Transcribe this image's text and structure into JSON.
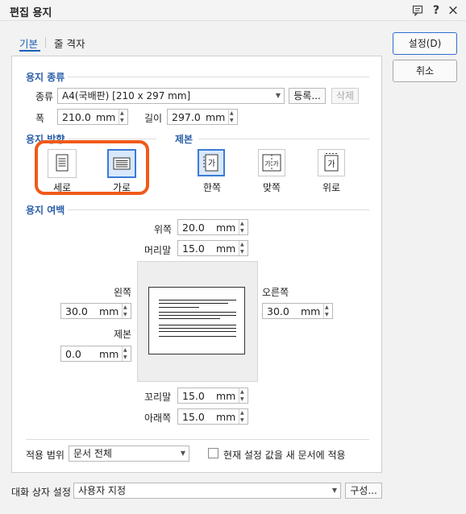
{
  "window": {
    "title": "편집 용지",
    "help_icon": "?",
    "close_icon": "×"
  },
  "tabs": [
    {
      "label": "기본"
    },
    {
      "label": "줄 격자"
    }
  ],
  "paper_kind": {
    "section_title": "용지 종류",
    "kind_label": "종류",
    "kind_value": "A4(국배판) [210 x 297 mm]",
    "register_button": "등록...",
    "delete_button": "삭제",
    "width_label": "폭",
    "width_value": "210.0",
    "width_unit": "mm",
    "length_label": "길이",
    "length_value": "297.0",
    "length_unit": "mm"
  },
  "orientation": {
    "section_title": "용지 방향",
    "portrait": "세로",
    "landscape": "가로",
    "selected": "landscape"
  },
  "binding": {
    "section_title": "제본",
    "single": "한쪽",
    "facing": "맞쪽",
    "top": "위로",
    "icon_glyph": "가",
    "selected": "single"
  },
  "margins": {
    "section_title": "용지 여백",
    "top_label": "위쪽",
    "top_value": "20.0",
    "header_label": "머리말",
    "header_value": "15.0",
    "left_label": "왼쪽",
    "left_value": "30.0",
    "right_label": "오른쪽",
    "right_value": "30.0",
    "gutter_label": "제본",
    "gutter_value": "0.0",
    "footer_label": "꼬리말",
    "footer_value": "15.0",
    "bottom_label": "아래쪽",
    "bottom_value": "15.0",
    "unit": "mm"
  },
  "apply": {
    "range_label": "적용 범위",
    "range_value": "문서 전체",
    "checkbox_label": "현재 설정 값을 새 문서에 적용"
  },
  "dialog_settings": {
    "label": "대화 상자 설정",
    "value": "사용자 지정",
    "config_button": "구성..."
  },
  "buttons": {
    "ok": "설정(D)",
    "cancel": "취소"
  },
  "colors": {
    "accent": "#2a5ea8",
    "highlight": "#f05a1a",
    "selected_bg": "#d9e8fb"
  }
}
